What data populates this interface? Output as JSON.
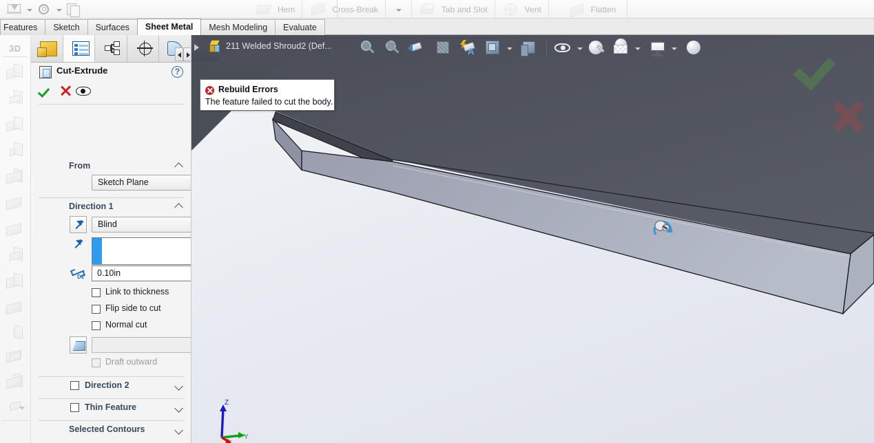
{
  "app": {
    "document_title": "211 Welded Shroud2  (Def..."
  },
  "quick_access": {
    "items": [
      {
        "name": "save-icon",
        "label": ""
      },
      {
        "name": "options-gear-icon",
        "label": ""
      },
      {
        "name": "new-document-icon",
        "label": ""
      }
    ]
  },
  "ribbon": {
    "groups": [
      {
        "icon": "hem-icon",
        "label": "Hem"
      },
      {
        "icon": "cross-break-icon",
        "label": "Cross-Break"
      },
      {
        "icon": "more-commands-caret",
        "label": ""
      },
      {
        "icon": "tab-and-slot-icon",
        "label": "Tab and Slot"
      },
      {
        "icon": "vent-icon",
        "label": "Vent"
      },
      {
        "icon": "flatten-icon",
        "label": "Flatten"
      }
    ]
  },
  "tabbar": {
    "tabs": [
      {
        "label": "Features",
        "active": false
      },
      {
        "label": "Sketch",
        "active": false
      },
      {
        "label": "Surfaces",
        "active": false
      },
      {
        "label": "Sheet Metal",
        "active": true
      },
      {
        "label": "Mesh Modeling",
        "active": false
      },
      {
        "label": "Evaluate",
        "active": false
      }
    ]
  },
  "left_toolbar": {
    "label_3d": "3D",
    "items": [
      {
        "name": "base-flange-icon"
      },
      {
        "name": "convert-to-sheet-metal-icon"
      },
      {
        "name": "lofted-bend-icon"
      },
      {
        "name": "edge-flange-icon"
      },
      {
        "name": "miter-flange-icon"
      },
      {
        "name": "hem-tool-icon"
      },
      {
        "name": "jog-icon"
      },
      {
        "name": "sketched-bend-icon"
      },
      {
        "name": "closed-corner-icon"
      },
      {
        "name": "welded-corner-icon"
      },
      {
        "name": "forming-tool-icon"
      },
      {
        "name": "extruded-cut-icon"
      },
      {
        "name": "flatten-tool-icon"
      }
    ]
  },
  "property_manager": {
    "tabs": [
      {
        "name": "feature-manager-tree-tab",
        "active": false
      },
      {
        "name": "property-manager-tab",
        "active": true
      },
      {
        "name": "configuration-manager-tab",
        "active": false
      },
      {
        "name": "dimxpert-manager-tab",
        "active": false
      },
      {
        "name": "display-manager-tab",
        "active": false
      }
    ],
    "scroll_left": "◄",
    "scroll_right": "►",
    "title": "Cut-Extrude",
    "help_label": "?",
    "actions": {
      "ok": "OK",
      "cancel": "Cancel",
      "preview": "Detailed Preview"
    },
    "sections": {
      "from": {
        "label": "From",
        "expanded": true,
        "start_condition": "Sketch Plane"
      },
      "direction1": {
        "label": "Direction 1",
        "expanded": true,
        "end_condition": "Blind",
        "reverse_direction_icon": "reverse-direction-arrow-icon",
        "direction_reference_placeholder": "",
        "depth_icon": "depth-dimension-icon",
        "depth_value": "0.10in",
        "checkboxes": [
          {
            "label": "Link to thickness",
            "checked": false,
            "disabled": false
          },
          {
            "label": "Flip side to cut",
            "checked": false,
            "disabled": false
          },
          {
            "label": "Normal cut",
            "checked": false,
            "disabled": false
          }
        ],
        "draft_icon": "draft-angle-icon",
        "draft_value": "",
        "draft_outward": {
          "label": "Draft outward",
          "checked": false,
          "disabled": true
        }
      },
      "direction2": {
        "label": "Direction 2",
        "checked": false,
        "expanded": false
      },
      "thin_feature": {
        "label": "Thin Feature",
        "checked": false,
        "expanded": false
      },
      "selected_contours": {
        "label": "Selected Contours",
        "expanded": false
      }
    }
  },
  "heads_up_toolbar": {
    "items": [
      {
        "name": "zoom-to-fit-icon"
      },
      {
        "name": "zoom-to-area-icon"
      },
      {
        "name": "previous-view-icon"
      },
      {
        "name": "section-view-icon"
      },
      {
        "name": "view-orientation-icon"
      },
      {
        "name": "display-style-icon"
      },
      {
        "name": "display-style-caret"
      },
      {
        "name": "apply-scene-icon"
      },
      {
        "name": "hide-show-items-icon"
      },
      {
        "name": "hide-show-caret"
      },
      {
        "name": "edit-appearance-icon"
      },
      {
        "name": "apply-scene-dropdown-icon"
      },
      {
        "name": "apply-scene-caret"
      },
      {
        "name": "view-settings-icon"
      },
      {
        "name": "view-settings-caret"
      },
      {
        "name": "rotate-view-sphere-icon"
      }
    ]
  },
  "window_controls": {
    "items": [
      {
        "name": "collapse-left-panel-button"
      },
      {
        "name": "expand-right-panel-button"
      },
      {
        "name": "minimize-button"
      },
      {
        "name": "restore-down-button"
      }
    ]
  },
  "tooltip": {
    "icon": "error-icon",
    "title": "Rebuild Errors",
    "message": "The feature failed to cut the body."
  },
  "confirmation_corner": {
    "ok_icon": "confirm-ok-checkmark",
    "cancel_icon": "confirm-cancel-x"
  },
  "axis_triad": {
    "x_label": "x",
    "y_label": "Y",
    "z_label": "Z",
    "x_color": "#d01010",
    "y_color": "#12a012",
    "z_color": "#1a1ac8"
  },
  "model": {
    "top_face_color": "#4f525c",
    "band_face_color": "#a0a4b4",
    "edge_color": "#1a1a20",
    "cursor_icon": "rotate-view-cursor"
  },
  "colors": {
    "graphics_bg_top": "#f3f5f8",
    "graphics_bg_bottom": "#dfe3ec",
    "toolbar_dark": "#4a4e57",
    "section_label": "#3a4a5c",
    "accent_blue": "#2f9bea"
  }
}
